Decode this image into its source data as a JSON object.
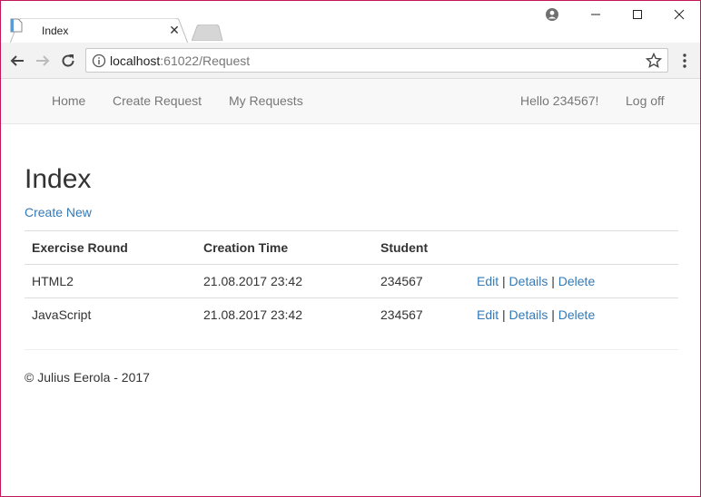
{
  "browser": {
    "tab_title": "Index",
    "url_host": "localhost",
    "url_rest": ":61022/Request"
  },
  "navbar": {
    "home": "Home",
    "create_request": "Create Request",
    "my_requests": "My Requests",
    "greeting": "Hello 234567!",
    "logoff": "Log off"
  },
  "page": {
    "title": "Index",
    "create_new": "Create New"
  },
  "table": {
    "headers": [
      "Exercise Round",
      "Creation Time",
      "Student",
      ""
    ],
    "rows": [
      {
        "exercise_round": "HTML2",
        "creation_time": "21.08.2017 23:42",
        "student": "234567",
        "edit": "Edit",
        "details": "Details",
        "delete": "Delete"
      },
      {
        "exercise_round": "JavaScript",
        "creation_time": "21.08.2017 23:42",
        "student": "234567",
        "edit": "Edit",
        "details": "Details",
        "delete": "Delete"
      }
    ],
    "separator": "|"
  },
  "footer": {
    "text": "© Julius Eerola - 2017"
  },
  "colors": {
    "link": "#337ab7",
    "navbar_bg": "#f8f8f8",
    "window_border": "#c2185b"
  },
  "icons": {
    "tab": "page-icon",
    "close": "close-icon",
    "back": "back-arrow-icon",
    "forward": "forward-arrow-icon",
    "reload": "reload-icon",
    "info": "info-icon",
    "star": "star-icon",
    "menu": "kebab-menu-icon",
    "profile": "profile-icon",
    "minimize": "minimize-icon",
    "maximize": "maximize-icon",
    "window_close": "window-close-icon"
  }
}
